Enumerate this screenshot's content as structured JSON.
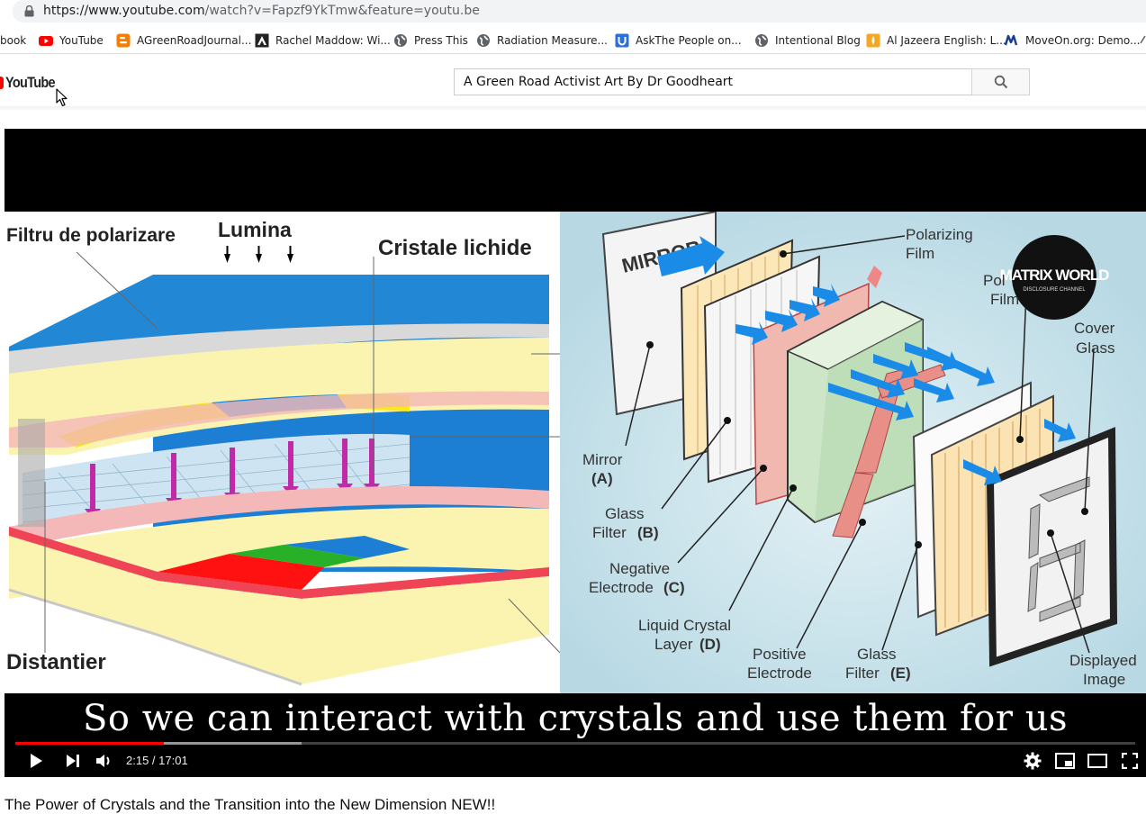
{
  "browser": {
    "url_main": "https://www.youtube.com",
    "url_path": "/watch?v=Fapzf9YkTmw&feature=youtu.be"
  },
  "bookmarks": [
    {
      "label": "book",
      "icon": "facebook-icon",
      "color": "#3b5998"
    },
    {
      "label": "YouTube",
      "icon": "youtube-icon",
      "color": "#ff0000"
    },
    {
      "label": "AGreenRoadJournal...",
      "icon": "blogger-icon",
      "color": "#f57d00"
    },
    {
      "label": "Rachel Maddow: Wi...",
      "icon": "msnbc-icon",
      "color": "#222222"
    },
    {
      "label": "Press This",
      "icon": "globe-icon",
      "color": "#5f6368"
    },
    {
      "label": "Radiation Measure...",
      "icon": "globe-icon",
      "color": "#5f6368"
    },
    {
      "label": "AskThe People on...",
      "icon": "u-icon",
      "color": "#2d6fd6"
    },
    {
      "label": "Intentional Blog",
      "icon": "globe-icon",
      "color": "#5f6368"
    },
    {
      "label": "Al Jazeera English: L...",
      "icon": "aljazeera-icon",
      "color": "#f5a623"
    },
    {
      "label": "MoveOn.org: Demo...",
      "icon": "moveon-icon",
      "color": "#1a3d8f"
    }
  ],
  "youtube": {
    "logo_text": "YouTube",
    "search_value": "A Green Road Activist Art By Dr Goodheart"
  },
  "video": {
    "caption": "So we can interact with crystals and use them for us",
    "time": "2:15 / 17:01",
    "progress": 0.133,
    "buffered": 0.256,
    "title": "The Power of Crystals and the Transition into the New Dimension NEW!!",
    "frame_left": {
      "label_filter": "Filtru de polarizare",
      "label_light": "Lumina",
      "label_crystals": "Cristale lichide",
      "label_spacer": "Distantier"
    },
    "frame_right": {
      "mirror": "MIRROR",
      "polarizing_film_1": "Polarizing",
      "polarizing_film_2": "Film",
      "pol_film_1": "Pol",
      "pol_film_2": "Film",
      "watermark_1": "MATRIX WORLD",
      "watermark_2": "DISCLOSURE CHANNEL",
      "cover_glass_1": "Cover",
      "cover_glass_2": "Glass",
      "mirror_a_1": "Mirror",
      "mirror_a_2": "(A)",
      "glass_b_1": "Glass",
      "glass_b_2": "Filter",
      "glass_b_3": "(B)",
      "neg_1": "Negative",
      "neg_2": "Electrode",
      "neg_3": "(C)",
      "lc_1": "Liquid Crystal",
      "lc_2": "Layer",
      "lc_3": "(D)",
      "pos_1": "Positive",
      "pos_2": "Electrode",
      "glass_e_1": "Glass",
      "glass_e_2": "Filter",
      "glass_e_3": "(E)",
      "disp_1": "Displayed",
      "disp_2": "Image"
    }
  },
  "colors": {
    "youtube_red": "#ff0000",
    "progress_red": "#ff0000"
  }
}
